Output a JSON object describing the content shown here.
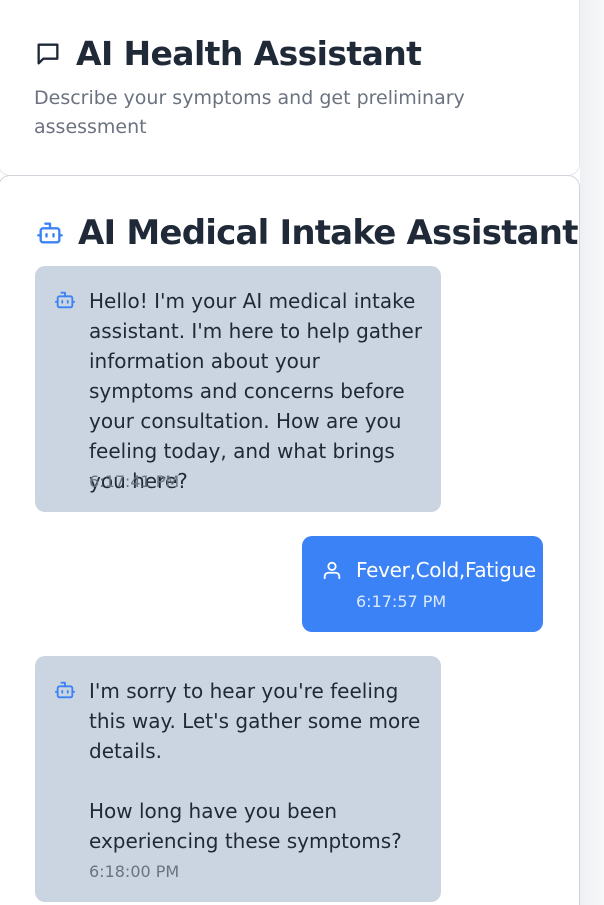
{
  "header": {
    "title": "AI Health Assistant",
    "subtitle": "Describe your symptoms and get preliminary assessment",
    "icon": "chat-bubble-icon"
  },
  "chat": {
    "title": "AI Medical Intake Assistant",
    "icon": "bot-icon",
    "messages": [
      {
        "role": "assistant",
        "text": "Hello! I'm your AI medical intake assistant. I'm here to help gather information about your symptoms and concerns before your consultation. How are you feeling today, and what brings you here?",
        "time": "6:17:41 PM",
        "icon": "bot-icon"
      },
      {
        "role": "user",
        "text": "Fever,Cold,Fatigue",
        "time": "6:17:57 PM",
        "icon": "user-icon"
      },
      {
        "role": "assistant",
        "text": "I'm sorry to hear you're feeling this way. Let's gather some more details.\n\nHow long have you been experiencing these symptoms?",
        "time": "6:18:00 PM",
        "icon": "bot-icon"
      }
    ]
  },
  "colors": {
    "assistant_bubble": "#cbd5e1",
    "user_bubble": "#3b82f6",
    "accent": "#3b82f6",
    "title_text": "#1f2937",
    "muted_text": "#6b7280"
  }
}
